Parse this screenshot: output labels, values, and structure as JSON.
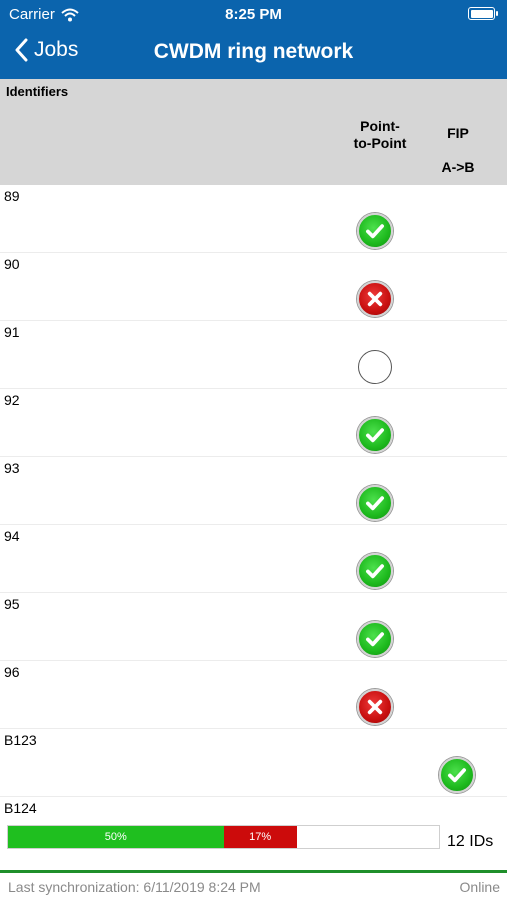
{
  "status_bar": {
    "carrier": "Carrier",
    "time": "8:25 PM"
  },
  "nav": {
    "back_label": "Jobs",
    "title": "CWDM ring network"
  },
  "table": {
    "headers": {
      "identifiers": "Identifiers",
      "point_to_point_line1": "Point-",
      "point_to_point_line2": "to-Point",
      "fip": "FIP",
      "fip_direction": "A->B"
    },
    "rows": [
      {
        "id": "89",
        "point_to_point": "pass",
        "fip": "none"
      },
      {
        "id": "90",
        "point_to_point": "fail",
        "fip": "none"
      },
      {
        "id": "91",
        "point_to_point": "pending",
        "fip": "none"
      },
      {
        "id": "92",
        "point_to_point": "pass",
        "fip": "none"
      },
      {
        "id": "93",
        "point_to_point": "pass",
        "fip": "none"
      },
      {
        "id": "94",
        "point_to_point": "pass",
        "fip": "none"
      },
      {
        "id": "95",
        "point_to_point": "pass",
        "fip": "none"
      },
      {
        "id": "96",
        "point_to_point": "fail",
        "fip": "none"
      },
      {
        "id": "B123",
        "point_to_point": "none",
        "fip": "pass"
      },
      {
        "id": "B124",
        "point_to_point": "none",
        "fip": "none"
      }
    ]
  },
  "summary": {
    "pass_percent": 50,
    "fail_percent": 17,
    "pass_label": "50%",
    "fail_label": "17%",
    "id_count": "12 IDs"
  },
  "footer": {
    "last_sync": "Last synchronization: 6/11/2019 8:24 PM",
    "connection": "Online"
  },
  "colors": {
    "header_blue": "#0b64ad",
    "pass_green": "#1fbf1f",
    "fail_red": "#cc0b0b",
    "footer_green": "#1f8f2a"
  },
  "icons": {
    "pass": "check-circle-icon",
    "fail": "x-circle-icon",
    "pending": "empty-circle-icon"
  }
}
